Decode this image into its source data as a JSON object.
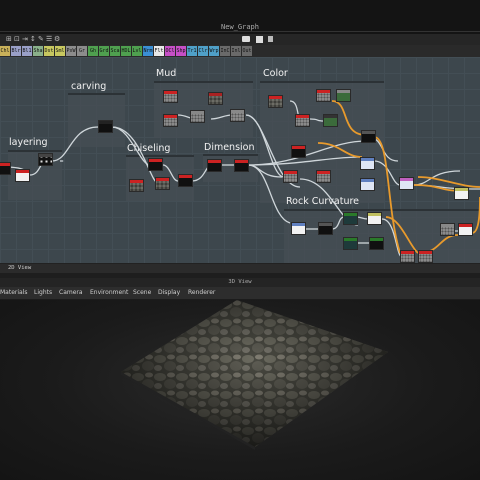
{
  "window": {
    "title": "New_Graph"
  },
  "toolbar": {
    "items": [
      "⊞",
      "⊡",
      "⇥",
      "↕",
      "✎",
      "☰",
      "⚙"
    ]
  },
  "filter_chips": [
    {
      "label": "Chl",
      "color": "#c9b15a"
    },
    {
      "label": "Blr",
      "color": "#9aa0c8"
    },
    {
      "label": "Bl1",
      "color": "#9aa0c8"
    },
    {
      "label": "Sha",
      "color": "#8ab08a"
    },
    {
      "label": "Dst",
      "color": "#c8c860"
    },
    {
      "label": "Sml",
      "color": "#c8c860"
    },
    {
      "label": "PxW",
      "color": "#8c8c8c"
    },
    {
      "label": "Gr",
      "color": "#8c8c8c"
    },
    {
      "label": "Gh",
      "color": "#4fa04f"
    },
    {
      "label": "Grd",
      "color": "#4fa04f"
    },
    {
      "label": "Sca",
      "color": "#4fa04f"
    },
    {
      "label": "HDL",
      "color": "#4fa04f"
    },
    {
      "label": "Lvl",
      "color": "#4fa04f"
    },
    {
      "label": "Nrm",
      "color": "#3b8fd4"
    },
    {
      "label": "Flt",
      "color": "#e8e8e8"
    },
    {
      "label": "OCl",
      "color": "#c64fc6"
    },
    {
      "label": "Shp",
      "color": "#c64fc6"
    },
    {
      "label": "Tr1",
      "color": "#4fa0c8"
    },
    {
      "label": "Clr",
      "color": "#4fa0c8"
    },
    {
      "label": "Wrp",
      "color": "#4fa0c8"
    },
    {
      "label": "InC",
      "color": "#6a6a6a"
    },
    {
      "label": "Inl",
      "color": "#6a6a6a"
    },
    {
      "label": "Out",
      "color": "#6a6a6a"
    }
  ],
  "frames": [
    {
      "title": "layering"
    },
    {
      "title": "carving"
    },
    {
      "title": "Mud"
    },
    {
      "title": "Color"
    },
    {
      "title": "Chiseling"
    },
    {
      "title": "Dimension"
    },
    {
      "title": "Rock Curvature"
    }
  ],
  "graph_tab": {
    "label": "2D View"
  },
  "viewer": {
    "title": "3D View"
  },
  "viewer_menu": [
    "Materials",
    "Lights",
    "Camera",
    "Environment",
    "Scene",
    "Display",
    "Renderer"
  ],
  "colors": {
    "canvas_bg": "#3d474d",
    "wire_default": "#cfd6da",
    "wire_highlight": "#e89a2c"
  }
}
